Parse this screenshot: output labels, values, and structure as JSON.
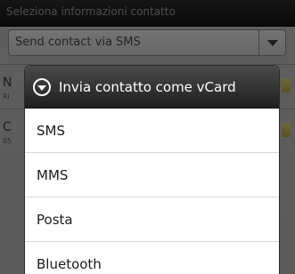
{
  "background": {
    "title": "Seleziona informazioni contatto",
    "spinner_value": "Send contact via SMS",
    "rows": [
      {
        "letter": "N",
        "sub": "Ri"
      },
      {
        "letter": "C",
        "sub": "05"
      }
    ]
  },
  "dialog": {
    "icon": "chevron-down-circle-icon",
    "title": "Invia contatto come vCard",
    "items": [
      {
        "label": "SMS"
      },
      {
        "label": "MMS"
      },
      {
        "label": "Posta"
      },
      {
        "label": "Bluetooth"
      }
    ]
  }
}
